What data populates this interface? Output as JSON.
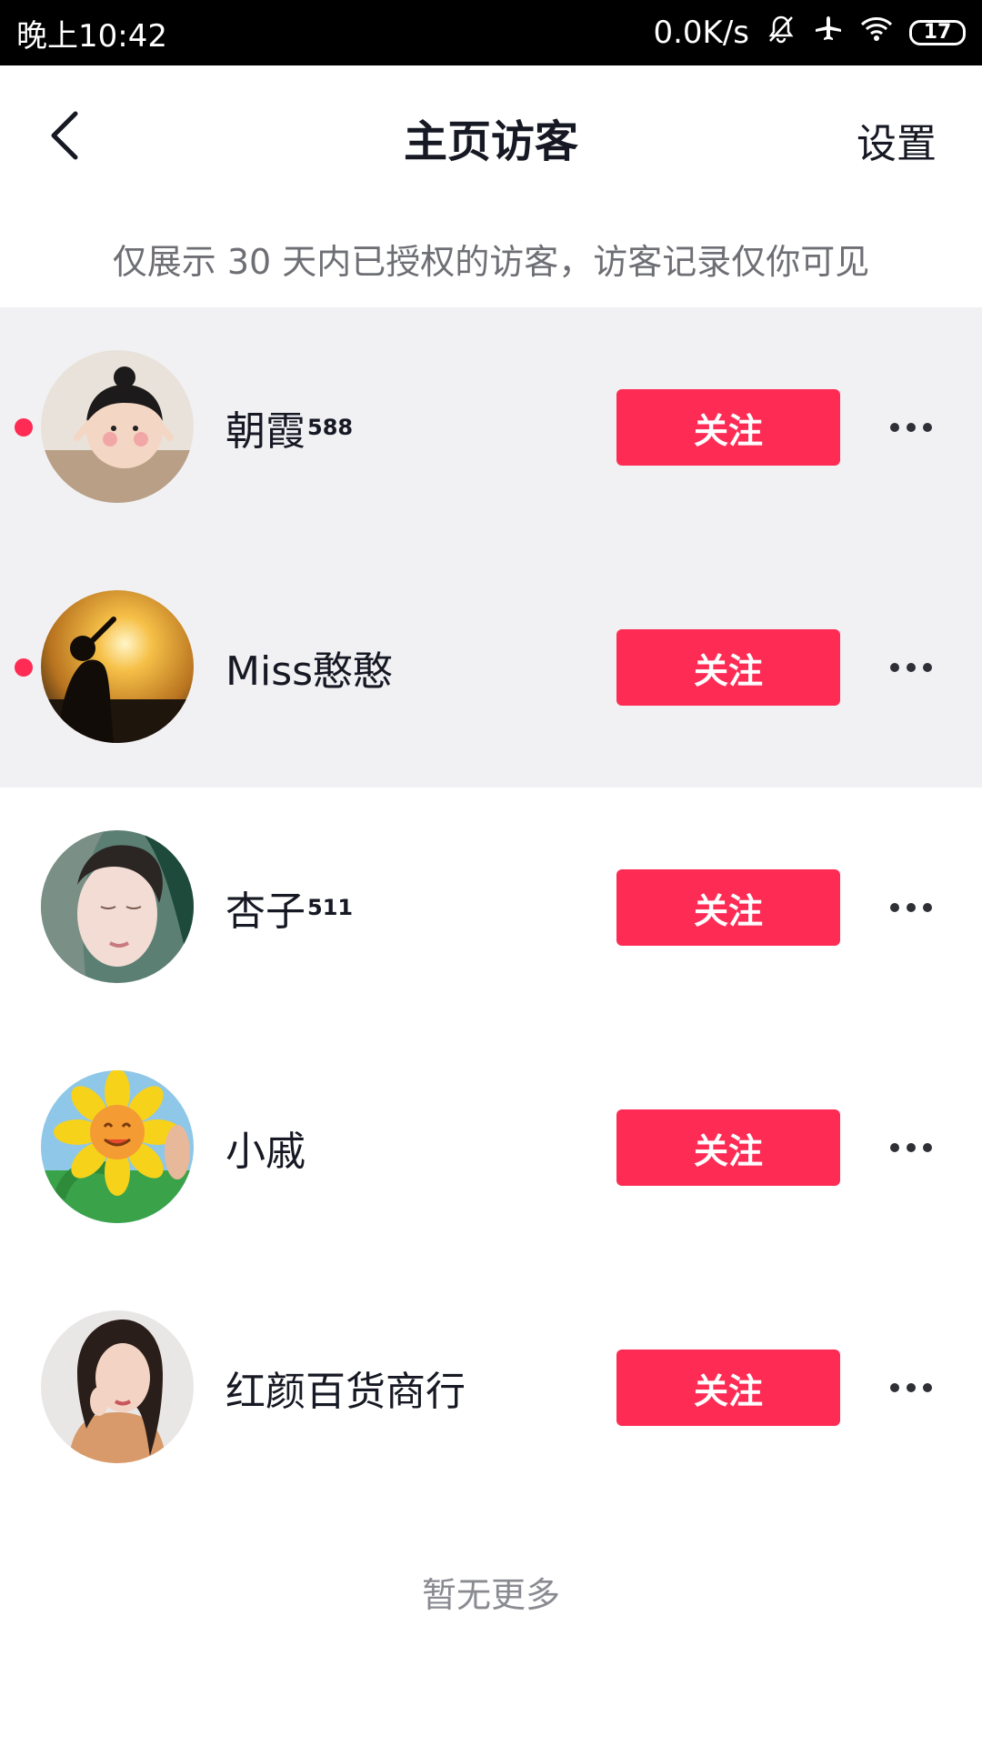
{
  "status_bar": {
    "time": "晚上10:42",
    "net_speed": "0.0K/s",
    "battery": "17",
    "icons": [
      "mute-bell-icon",
      "airplane-icon",
      "wifi-icon",
      "battery-icon"
    ]
  },
  "header": {
    "title": "主页访客",
    "settings_label": "设置",
    "back_icon": "chevron-left-icon"
  },
  "notice": "仅展示 30 天内已授权的访客，访客记录仅你可见",
  "visitors": [
    {
      "name": "朝霞",
      "suffix": "588",
      "unread": true,
      "follow_label": "关注"
    },
    {
      "name": "Miss憨憨",
      "suffix": "",
      "unread": true,
      "follow_label": "关注"
    },
    {
      "name": "杏子",
      "suffix": "511",
      "unread": false,
      "follow_label": "关注"
    },
    {
      "name": "小戚",
      "suffix": "",
      "unread": false,
      "follow_label": "关注"
    },
    {
      "name": "红颜百货商行",
      "suffix": "",
      "unread": false,
      "follow_label": "关注"
    }
  ],
  "footer": "暂无更多",
  "colors": {
    "accent": "#fe2c55",
    "unread_bg": "#f1f1f4",
    "text_primary": "#161823",
    "text_secondary": "#6e6f75"
  }
}
